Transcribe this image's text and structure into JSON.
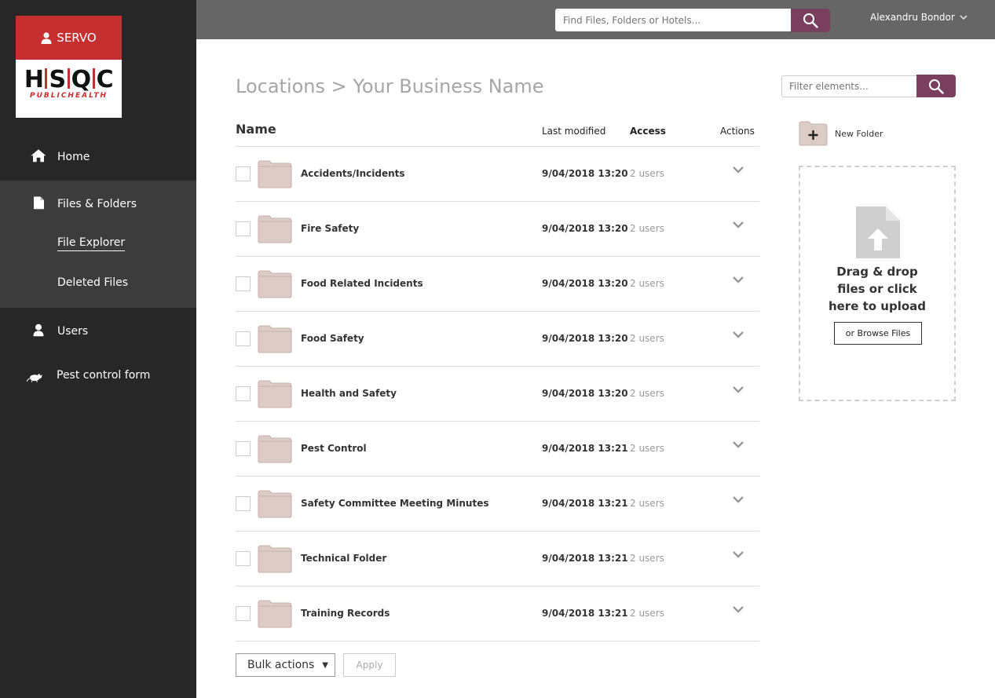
{
  "brand": {
    "servo_label": "SERVO",
    "logo_letters": [
      "H",
      "S",
      "Q",
      "C"
    ],
    "logo_subtitle": "PUBLICHEALTH"
  },
  "topbar": {
    "search_placeholder": "Find Files, Folders or Hotels...",
    "user_name": "Alexandru Bondor"
  },
  "sidebar": {
    "home": "Home",
    "files_folders": "Files & Folders",
    "file_explorer": "File Explorer",
    "deleted_files": "Deleted Files",
    "users": "Users",
    "pest_control": "Pest control form"
  },
  "main": {
    "breadcrumb": "Locations > Your Business Name",
    "filter_placeholder": "Filter elements...",
    "columns": {
      "name": "Name",
      "last_modified": "Last modified",
      "access": "Access",
      "actions": "Actions"
    },
    "rows": [
      {
        "name": "Accidents/Incidents",
        "modified": "9/04/2018 13:20",
        "access": "2 users"
      },
      {
        "name": "Fire Safety",
        "modified": "9/04/2018 13:20",
        "access": "2 users"
      },
      {
        "name": "Food Related Incidents",
        "modified": "9/04/2018 13:20",
        "access": "2 users"
      },
      {
        "name": "Food Safety",
        "modified": "9/04/2018 13:20",
        "access": "2 users"
      },
      {
        "name": "Health and Safety",
        "modified": "9/04/2018 13:20",
        "access": "2 users"
      },
      {
        "name": "Pest Control",
        "modified": "9/04/2018 13:21",
        "access": "2 users"
      },
      {
        "name": "Safety Committee Meeting Minutes",
        "modified": "9/04/2018 13:21",
        "access": "2 users"
      },
      {
        "name": "Technical Folder",
        "modified": "9/04/2018 13:21",
        "access": "2 users"
      },
      {
        "name": "Training Records",
        "modified": "9/04/2018 13:21",
        "access": "2 users"
      }
    ],
    "bulk_actions": "Bulk actions",
    "apply": "Apply"
  },
  "side_panel": {
    "new_folder": "New Folder",
    "drop_line1": "Drag & drop",
    "drop_line2": "files or click",
    "drop_line3": "here to upload",
    "browse": "or Browse Files"
  },
  "colors": {
    "sidebar_bg": "#272727",
    "sidebar_active_bg": "#3c3c3c",
    "brand_red": "#c62f2f",
    "topbar_bg": "#666666",
    "accent_plum": "#7a3f5f",
    "folder_fill": "#dccbc6"
  },
  "icons": [
    "user-icon",
    "home-icon",
    "file-icon",
    "user-icon",
    "rat-icon",
    "search-icon",
    "chevron-down-icon",
    "folder-icon",
    "folder-plus-icon",
    "upload-file-icon"
  ]
}
